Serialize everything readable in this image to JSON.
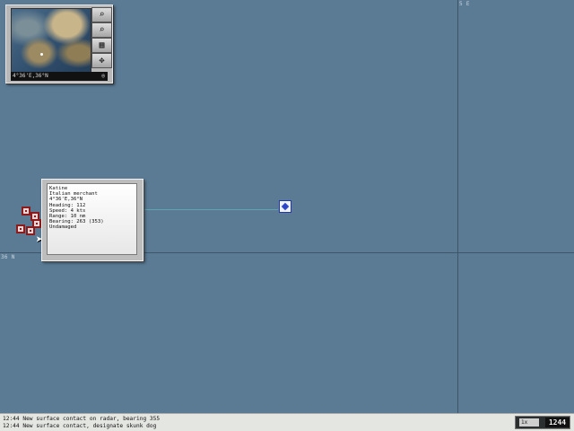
{
  "map": {
    "grid_lon_label": "5 E",
    "grid_lat_label": "36 N"
  },
  "minimap": {
    "coords": "4°36'E,36°N",
    "buttons": [
      {
        "icon": "zoom-in-icon",
        "glyph": "⌕"
      },
      {
        "icon": "zoom-out-icon",
        "glyph": "⌕"
      },
      {
        "icon": "grid-icon",
        "glyph": "▦"
      },
      {
        "icon": "center-icon",
        "glyph": "✥"
      }
    ],
    "indicator_glyph": "◎"
  },
  "contact_info": {
    "lines": [
      "Katine",
      "Italian merchant",
      "4°36'E,36°N",
      "Heading: 112",
      "Speed: 4 kts",
      "Range: 10 nm",
      "Bearing: 263 (353)",
      "Undamaged"
    ]
  },
  "messages": [
    "12:44 New surface contact on radar, bearing 355",
    "12:44 New surface contact, designate skunk dog"
  ],
  "time": {
    "compression": "1x",
    "clock": "1244"
  },
  "colors": {
    "ocean": "#5b7b95",
    "contact_hostile": "#8c1c1c",
    "contact_neutral": "#2c46c9"
  }
}
